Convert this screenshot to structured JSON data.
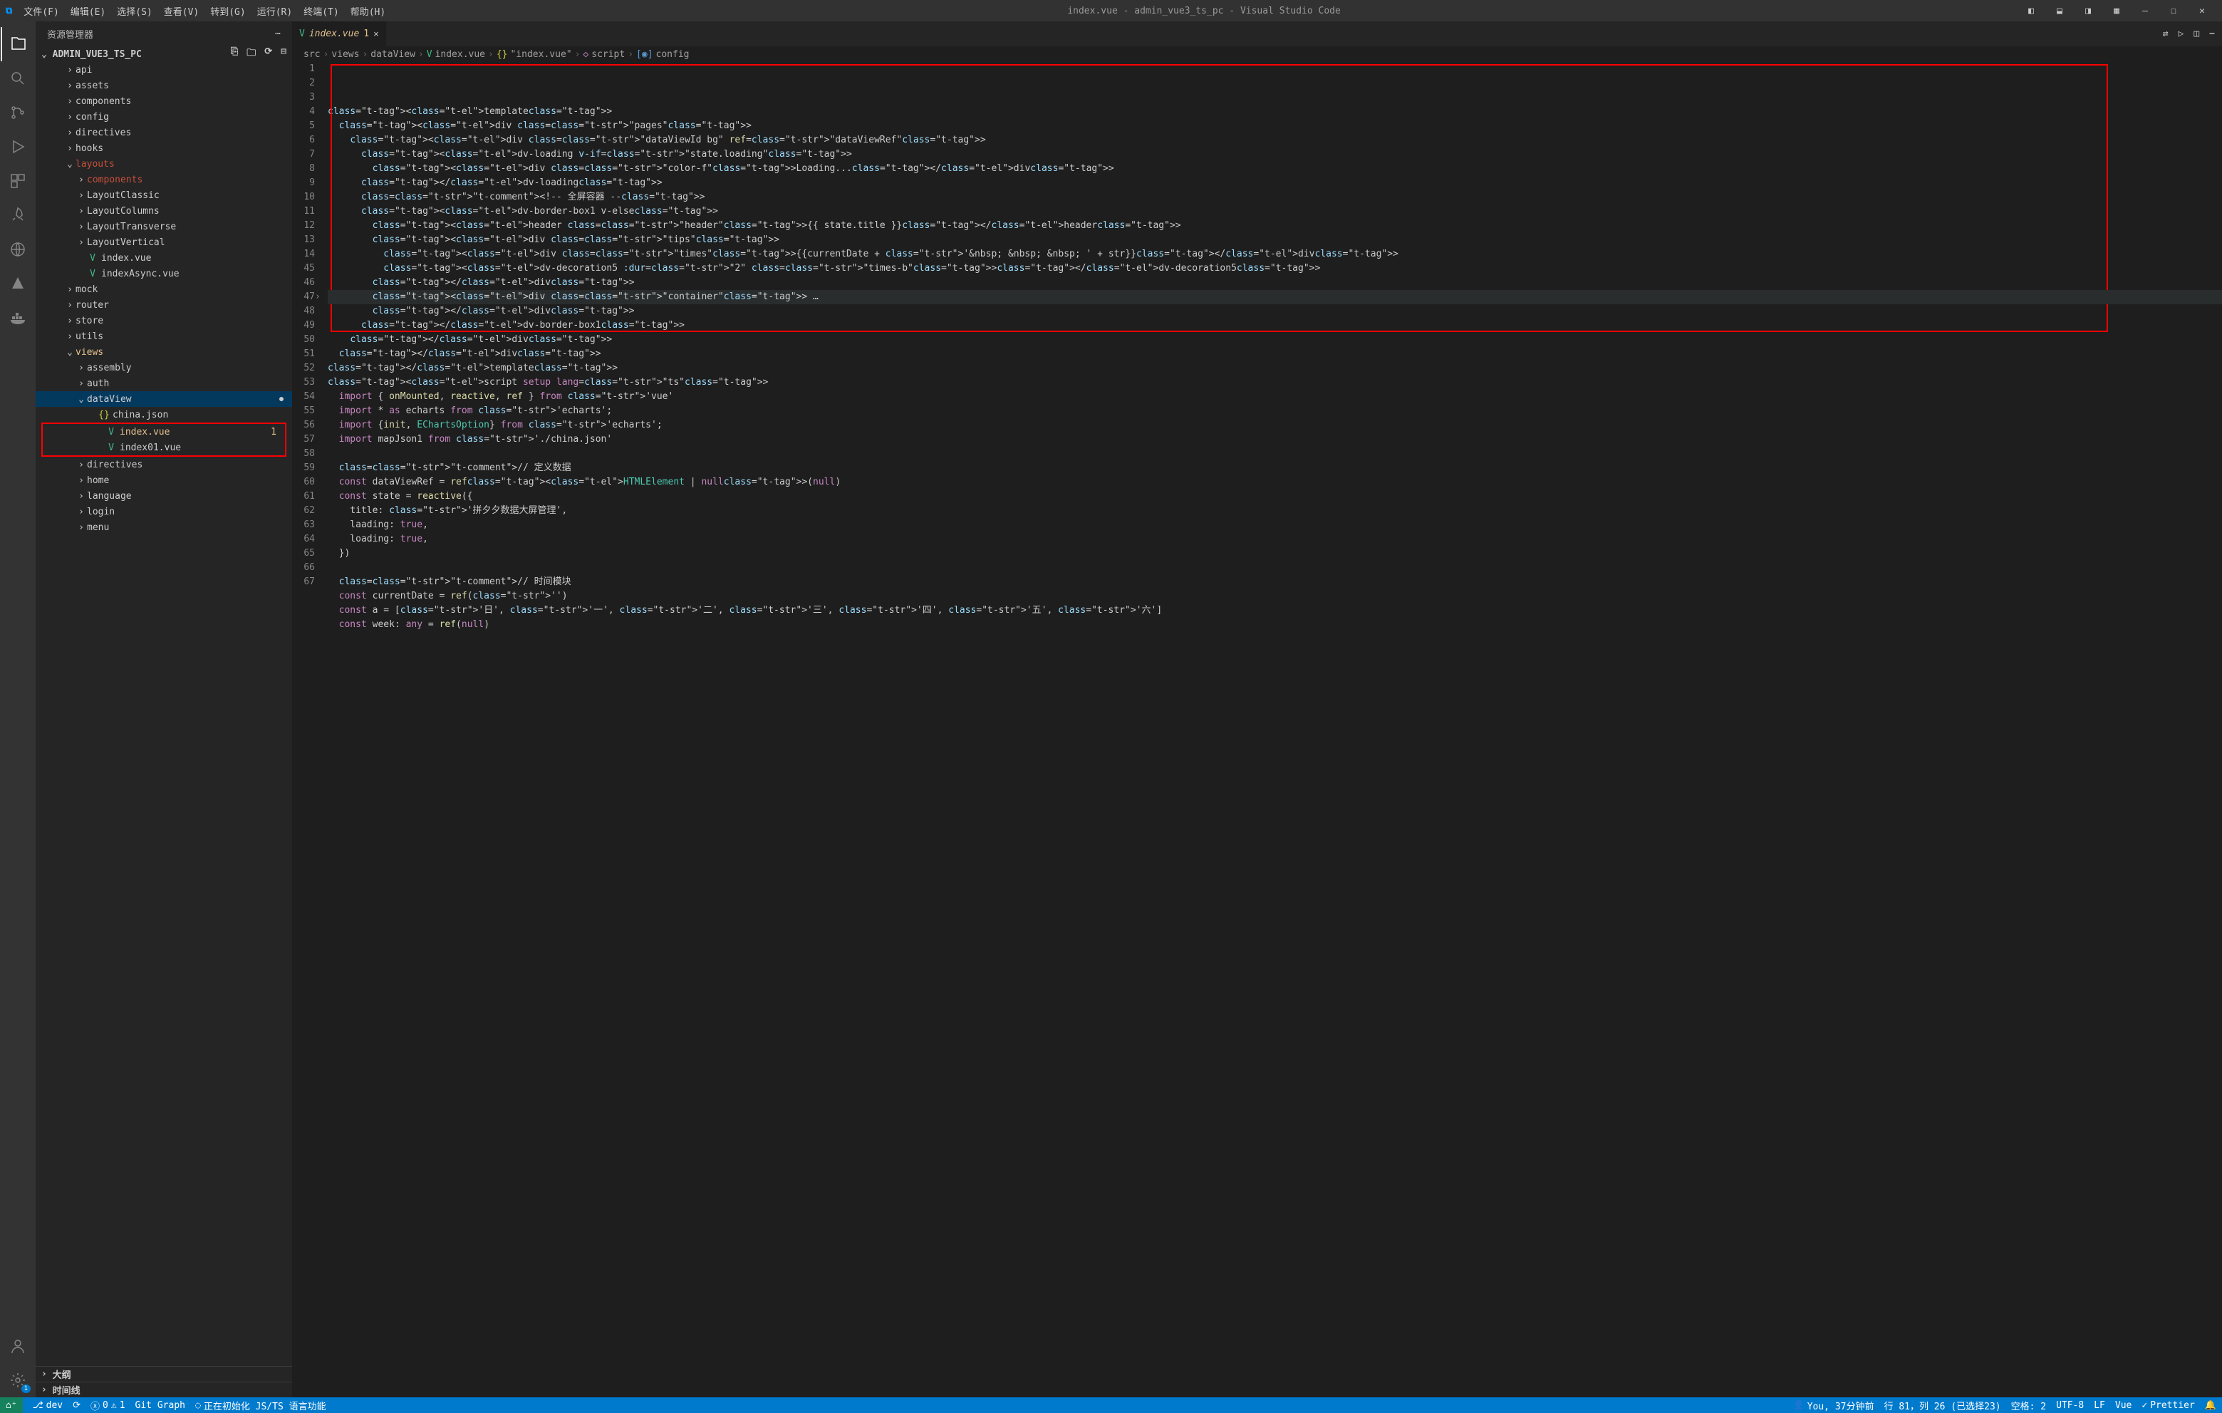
{
  "app": {
    "title": "index.vue - admin_vue3_ts_pc - Visual Studio Code"
  },
  "menu": {
    "file": "文件(F)",
    "edit": "编辑(E)",
    "select": "选择(S)",
    "view": "查看(V)",
    "goto": "转到(G)",
    "run": "运行(R)",
    "terminal": "终端(T)",
    "help": "帮助(H)"
  },
  "sidebar": {
    "title": "资源管理器",
    "project": "ADMIN_VUE3_TS_PC",
    "outline": "大纲",
    "timeline": "时间线",
    "tree": [
      {
        "label": "api",
        "indent": 2,
        "chev": ">"
      },
      {
        "label": "assets",
        "indent": 2,
        "chev": ">"
      },
      {
        "label": "components",
        "indent": 2,
        "chev": ">"
      },
      {
        "label": "config",
        "indent": 2,
        "chev": ">"
      },
      {
        "label": "directives",
        "indent": 2,
        "chev": ">"
      },
      {
        "label": "hooks",
        "indent": 2,
        "chev": ">"
      },
      {
        "label": "layouts",
        "indent": 2,
        "chev": "v",
        "color": "red"
      },
      {
        "label": "components",
        "indent": 3,
        "chev": ">",
        "color": "red"
      },
      {
        "label": "LayoutClassic",
        "indent": 3,
        "chev": ">"
      },
      {
        "label": "LayoutColumns",
        "indent": 3,
        "chev": ">"
      },
      {
        "label": "LayoutTransverse",
        "indent": 3,
        "chev": ">"
      },
      {
        "label": "LayoutVertical",
        "indent": 3,
        "chev": ">"
      },
      {
        "label": "index.vue",
        "indent": 3,
        "icon": "V",
        "iconClass": "vue-icon"
      },
      {
        "label": "indexAsync.vue",
        "indent": 3,
        "icon": "V",
        "iconClass": "vue-icon"
      },
      {
        "label": "mock",
        "indent": 2,
        "chev": ">"
      },
      {
        "label": "router",
        "indent": 2,
        "chev": ">"
      },
      {
        "label": "store",
        "indent": 2,
        "chev": ">"
      },
      {
        "label": "utils",
        "indent": 2,
        "chev": ">"
      },
      {
        "label": "views",
        "indent": 2,
        "chev": "v",
        "color": "orange"
      },
      {
        "label": "assembly",
        "indent": 3,
        "chev": ">"
      },
      {
        "label": "auth",
        "indent": 3,
        "chev": ">"
      },
      {
        "label": "dataView",
        "indent": 3,
        "chev": "v",
        "selected": true,
        "dot": true
      },
      {
        "label": "china.json",
        "indent": 4,
        "icon": "{}",
        "iconClass": "json-icon"
      },
      {
        "label": "index.vue",
        "indent": 4,
        "icon": "V",
        "iconClass": "vue-icon",
        "color": "orange",
        "badge": "1",
        "hl": true
      },
      {
        "label": "index01.vue",
        "indent": 4,
        "icon": "V",
        "iconClass": "vue-icon",
        "hl": true
      },
      {
        "label": "directives",
        "indent": 3,
        "chev": ">"
      },
      {
        "label": "home",
        "indent": 3,
        "chev": ">"
      },
      {
        "label": "language",
        "indent": 3,
        "chev": ">"
      },
      {
        "label": "login",
        "indent": 3,
        "chev": ">"
      },
      {
        "label": "menu",
        "indent": 3,
        "chev": ">"
      }
    ]
  },
  "editor": {
    "tab": {
      "label": "index.vue",
      "badge": "1"
    },
    "breadcrumbs": [
      "src",
      "views",
      "dataView",
      "index.vue",
      "\"index.vue\"",
      "script",
      "config"
    ],
    "lines_start": 1,
    "lines_end": 67,
    "current_line": 14
  },
  "code": {
    "l1": {
      "raw": "<template>"
    },
    "l2": {
      "raw": "  <div class=\"pages\">"
    },
    "l3": {
      "raw": "    <div class=\"dataViewId bg\" ref=\"dataViewRef\">"
    },
    "l4": {
      "raw": "      <dv-loading v-if=\"state.loading\">"
    },
    "l5": {
      "raw": "        <div class=\"color-f\">Loading...</div>"
    },
    "l6": {
      "raw": "      </dv-loading>"
    },
    "l7": {
      "raw": "      <!-- 全屏容器 -->"
    },
    "l8": {
      "raw": "      <dv-border-box1 v-else>"
    },
    "l9": {
      "raw": "        <header class=\"header\">{{ state.title }}</header>"
    },
    "l10": {
      "raw": "        <div class=\"tips\">"
    },
    "l11": {
      "raw": "          <div class=\"times\">{{currentDate + '&nbsp; &nbsp; &nbsp; ' + str}}</div>"
    },
    "l12": {
      "raw": "          <dv-decoration5 :dur=\"2\" class=\"times-b\"></dv-decoration5>"
    },
    "l13": {
      "raw": "        </div>"
    },
    "l14": {
      "raw": "        <div class=\"container\"> …"
    },
    "l45": {
      "raw": "        </div>"
    },
    "l46": {
      "raw": "      </dv-border-box1>"
    },
    "l47": {
      "raw": "    </div>"
    },
    "l48": {
      "raw": "  </div>"
    },
    "l49": {
      "raw": "</template>"
    },
    "l50": {
      "raw": "<script setup lang=\"ts\">"
    },
    "l51": {
      "raw": "  import { onMounted, reactive, ref } from 'vue'"
    },
    "l52": {
      "raw": "  import * as echarts from 'echarts';"
    },
    "l53": {
      "raw": "  import {init, EChartsOption} from 'echarts';"
    },
    "l54": {
      "raw": "  import mapJson1 from './china.json'"
    },
    "l55": {
      "raw": ""
    },
    "l56": {
      "raw": "  // 定义数据"
    },
    "l57": {
      "raw": "  const dataViewRef = ref<HTMLElement | null>(null)"
    },
    "l58": {
      "raw": "  const state = reactive({"
    },
    "l59": {
      "raw": "    title: '拼夕夕数据大屏管理',"
    },
    "l60": {
      "raw": "    laading: true,"
    },
    "l61": {
      "raw": "    loading: true,"
    },
    "l62": {
      "raw": "  })"
    },
    "l63": {
      "raw": ""
    },
    "l64": {
      "raw": "  // 时间模块"
    },
    "l65": {
      "raw": "  const currentDate = ref('')"
    },
    "l66": {
      "raw": "  const a = ['日', '一', '二', '三', '四', '五', '六']"
    },
    "l67": {
      "raw": "  const week: any = ref(null)"
    }
  },
  "status": {
    "remote": "",
    "branch": "dev",
    "sync": "",
    "errors": "0",
    "warnings": "1",
    "gitgraph": "Git Graph",
    "initializing": "正在初始化 JS/TS 语言功能",
    "you": "You, 37分钟前",
    "cursor": "行 81，列 26 (已选择23)",
    "spaces": "空格: 2",
    "encoding": "UTF-8",
    "eol": "LF",
    "lang": "Vue",
    "prettier": "Prettier"
  }
}
